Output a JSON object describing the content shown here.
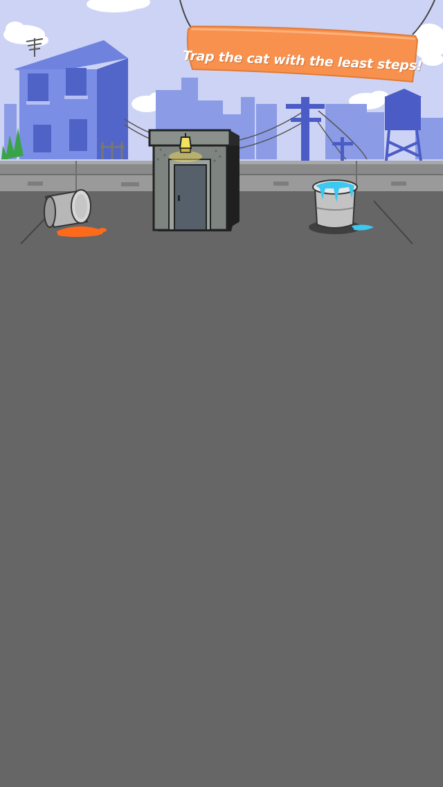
{
  "game": {
    "banner_text": "Trap the cat with the least steps!"
  },
  "colors": {
    "sky": "#cdd3f4",
    "ground": "#666666",
    "banner": "#f7914d",
    "building": "#6f83de",
    "skyline": "#8b9be6",
    "orange_paint": "#ff6a1a",
    "blue_paint": "#3cc8f0"
  },
  "icons": [
    "apartment-building",
    "antenna",
    "water-tower",
    "utility-pole",
    "rooftop-exit-door",
    "wall-lamp",
    "tipped-bucket",
    "paint-bucket"
  ]
}
